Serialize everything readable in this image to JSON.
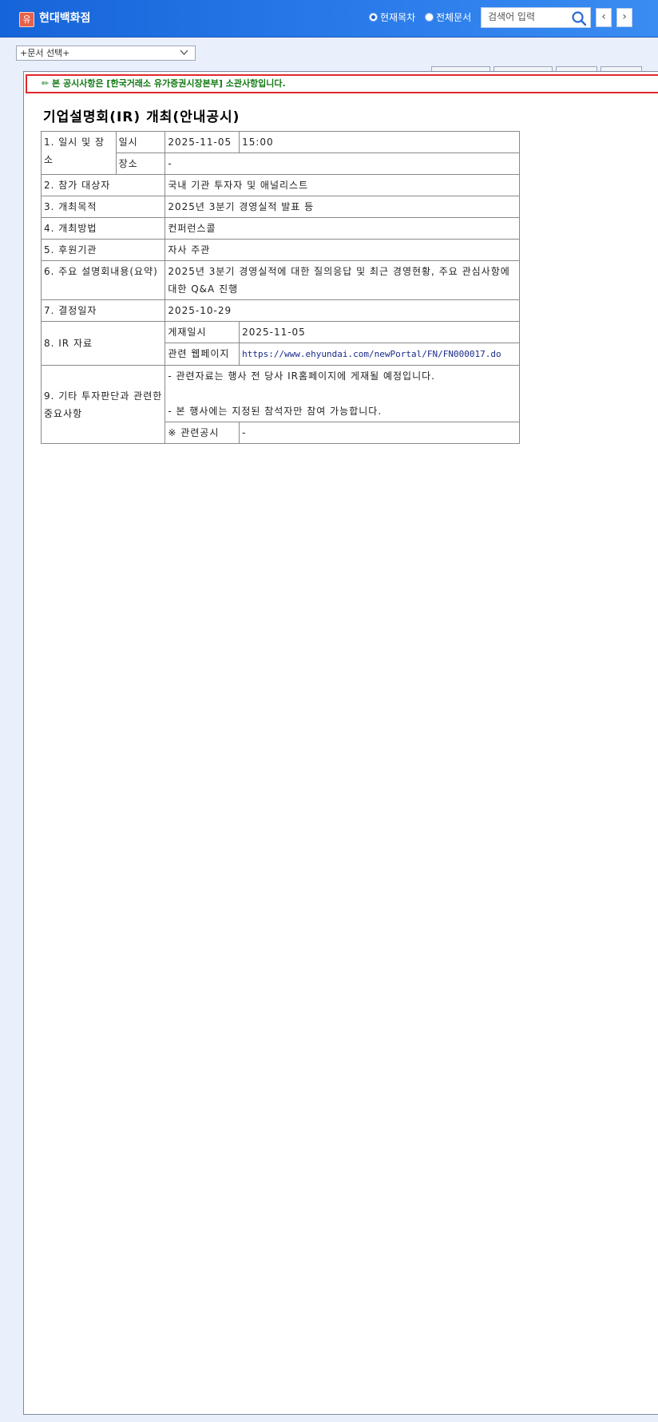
{
  "header": {
    "logo_char": "유",
    "title": "현대백화점",
    "radio_current": "현재목차",
    "radio_all": "전체문서",
    "search_placeholder": "검색어 입력",
    "prev_label": "‹",
    "next_label": "›"
  },
  "doc_select": {
    "value": "+문서 선택+"
  },
  "notice": "✏ 본 공시사항은 [한국거래소 유가증권시장본부] 소관사항입니다.",
  "document": {
    "title": "기업설명회(IR) 개최(안내공시)",
    "rows": {
      "r1_label": "1. 일시 및 장소",
      "r1_date_label": "일시",
      "r1_date": "2025-11-05",
      "r1_time": "15:00",
      "r1_place_label": "장소",
      "r1_place": "-",
      "r2_label": "2. 참가 대상자",
      "r2_value": "국내 기관 투자자 및 애널리스트",
      "r3_label": "3. 개최목적",
      "r3_value": "2025년 3분기 경영실적 발표 등",
      "r4_label": "4. 개최방법",
      "r4_value": "컨퍼런스콜",
      "r5_label": "5. 후원기관",
      "r5_value": "자사 주관",
      "r6_label": "6. 주요 설명회내용(요약)",
      "r6_value": "2025년 3분기 경영실적에 대한 질의응답 및 최근 경영현황, 주요 관심사항에 대한 Q&A 진행",
      "r7_label": "7. 결정일자",
      "r7_value": "2025-10-29",
      "r8_label": "8. IR 자료",
      "r8_post_label": "게재일시",
      "r8_post_value": "2025-11-05",
      "r8_web_label": "관련 웹페이지",
      "r8_web_value": "https://www.ehyundai.com/newPortal/FN/FN000017.do",
      "r9_label": "9. 기타 투자판단과 관련한 중요사항",
      "r9_line1": "- 관련자료는 행사 전 당사 IR홈페이지에 게재될 예정입니다.",
      "r9_line2": "- 본 행사에는 지정된 참석자만 참여 가능합니다.",
      "r9_related_label": "※ 관련공시",
      "r9_related_value": "-"
    }
  },
  "colors": {
    "header_blue": "#1664d9",
    "notice_border": "#e0282e",
    "notice_text": "#117a13"
  }
}
